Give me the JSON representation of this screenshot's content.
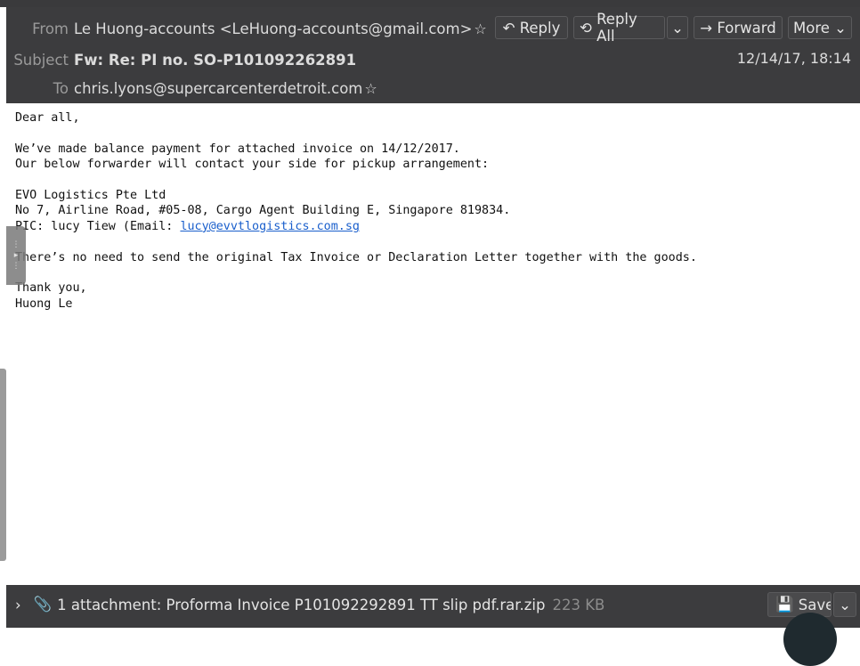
{
  "header": {
    "from_label": "From",
    "from_value": "Le Huong-accounts <LeHuong-accounts@gmail.com>",
    "subject_label": "Subject",
    "subject_value": "Fw: Re: PI no. SO-P101092262891",
    "to_label": "To",
    "to_value": "chris.lyons@supercarcenterdetroit.com",
    "date": "12/14/17, 18:14",
    "buttons": {
      "reply": "Reply",
      "reply_all": "Reply All",
      "forward": "Forward",
      "more": "More"
    }
  },
  "body": {
    "greeting": "Dear all,",
    "line1": "We’ve made balance payment for attached invoice on 14/12/2017.",
    "line2": "Our below forwarder will contact your side for pickup arrangement:",
    "company": "EVO Logistics Pte Ltd",
    "address": "No 7, Airline Road, #05-08, Cargo Agent Building E, Singapore 819834.",
    "pic_prefix": "PIC: lucy Tiew (Email: ",
    "pic_email": "lucy@evvtlogistics.com.sg",
    "note": "There’s no need to send the original Tax Invoice or Declaration Letter together with the goods.",
    "thanks": "Thank you,",
    "signature": "Huong Le"
  },
  "attachment": {
    "summary": "1 attachment: Proforma Invoice P101092292891 TT slip pdf.rar.zip",
    "size": "223 KB",
    "save_label": "Save"
  },
  "colors": {
    "header_bg": "#3c3c3e",
    "link": "#1a5fcc"
  }
}
